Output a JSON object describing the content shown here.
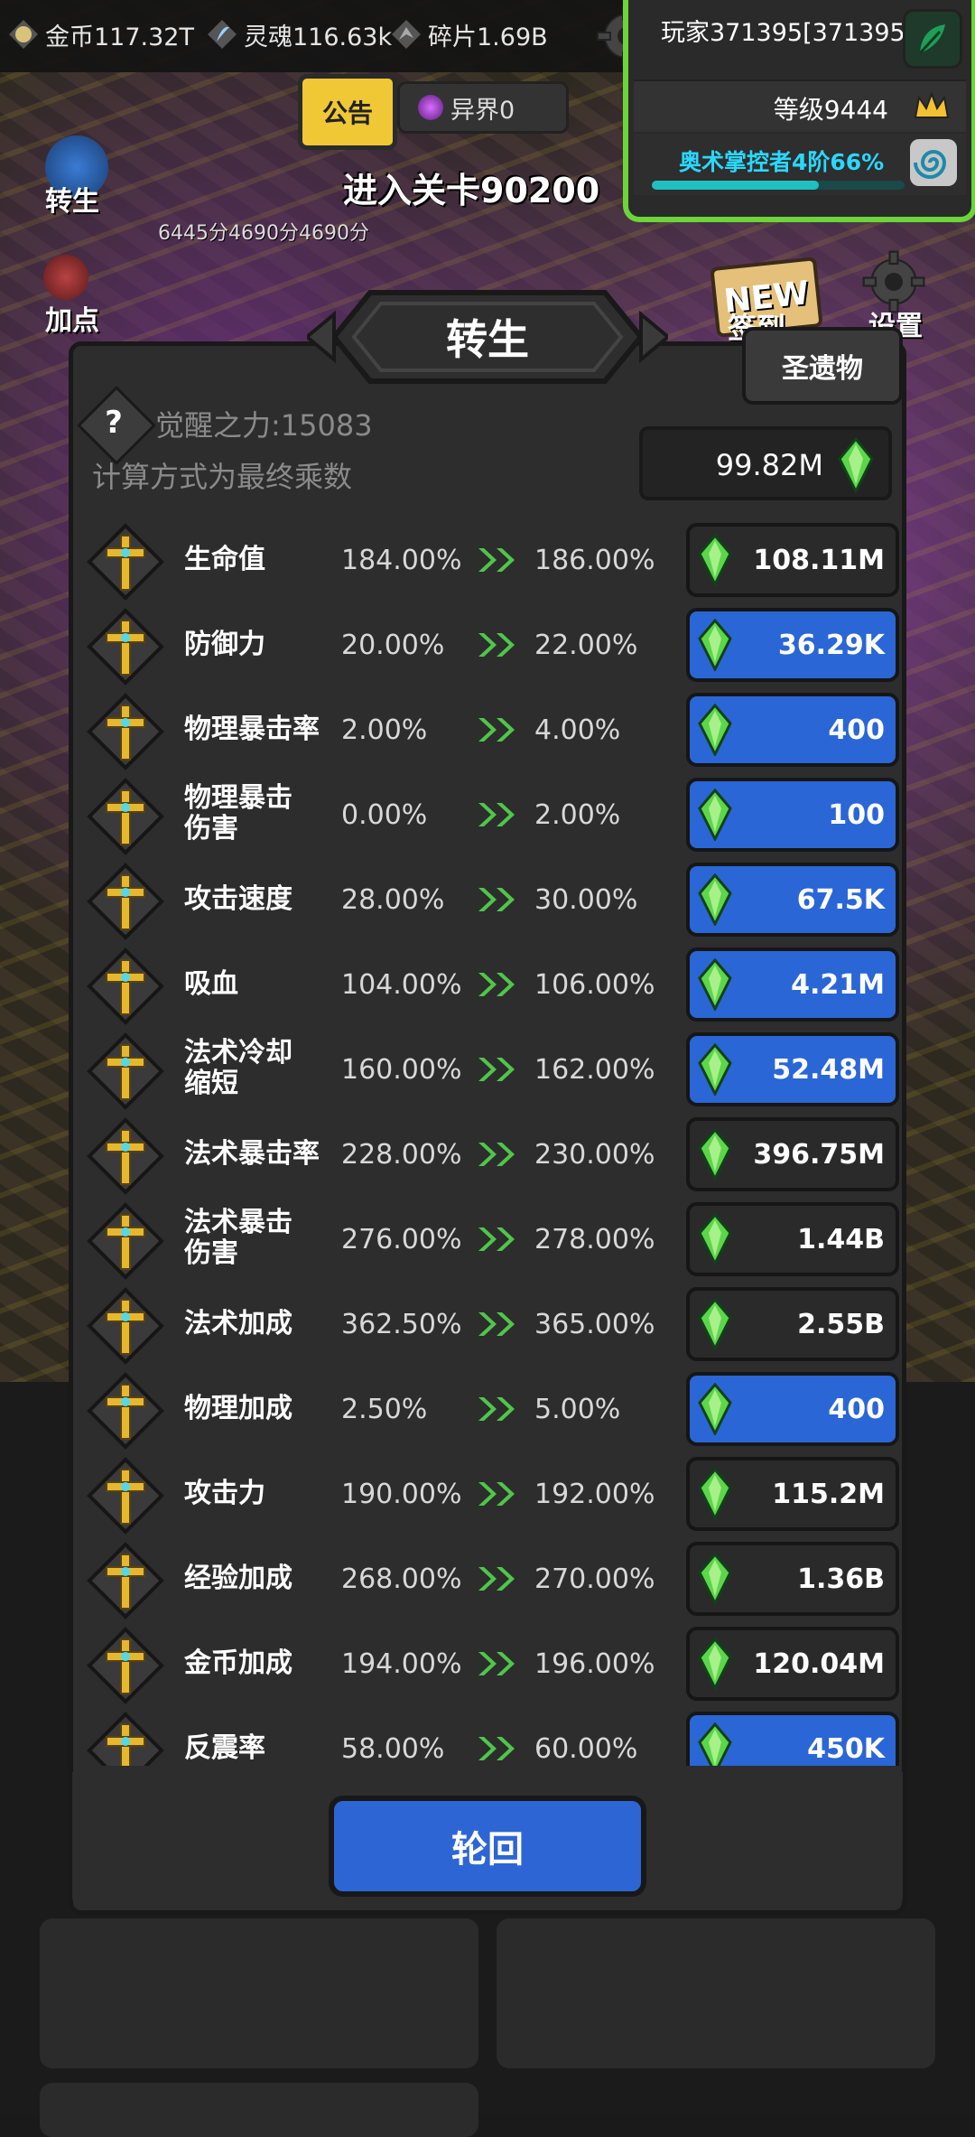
{
  "resources": {
    "gold": "金币117.32T",
    "soul": "灵魂116.63k",
    "shard": "碎片1.69B"
  },
  "player": {
    "name": "玩家371395[371395]",
    "level": "等级9444",
    "title": "奥术掌控者4阶66%",
    "title_progress": 0.66
  },
  "top_buttons": {
    "notice": "公告",
    "realm": "异界0"
  },
  "side_menu": {
    "rebirth": "转生",
    "add_points": "加点",
    "checkin": "签到",
    "settings": "设置",
    "new_badge": "NEW"
  },
  "stage": {
    "title": "进入关卡90200",
    "score": "6445分4690分4690分"
  },
  "dialog": {
    "title": "转生",
    "relic_button": "圣遗物",
    "help_mark": "?",
    "awaken_power": "觉醒之力:15083",
    "calc_note": "计算方式为最终乘数",
    "total_cost": "99.82M",
    "reincarnate_button": "轮回"
  },
  "stats": [
    {
      "name": "生命值",
      "current": "184.00%",
      "next": "186.00%",
      "cost": "108.11M",
      "affordable": false
    },
    {
      "name": "防御力",
      "current": "20.00%",
      "next": "22.00%",
      "cost": "36.29K",
      "affordable": true
    },
    {
      "name": "物理暴击率",
      "current": "2.00%",
      "next": "4.00%",
      "cost": "400",
      "affordable": true
    },
    {
      "name": "物理暴击伤害",
      "current": "0.00%",
      "next": "2.00%",
      "cost": "100",
      "affordable": true
    },
    {
      "name": "攻击速度",
      "current": "28.00%",
      "next": "30.00%",
      "cost": "67.5K",
      "affordable": true
    },
    {
      "name": "吸血",
      "current": "104.00%",
      "next": "106.00%",
      "cost": "4.21M",
      "affordable": true
    },
    {
      "name": "法术冷却缩短",
      "current": "160.00%",
      "next": "162.00%",
      "cost": "52.48M",
      "affordable": true
    },
    {
      "name": "法术暴击率",
      "current": "228.00%",
      "next": "230.00%",
      "cost": "396.75M",
      "affordable": false
    },
    {
      "name": "法术暴击伤害",
      "current": "276.00%",
      "next": "278.00%",
      "cost": "1.44B",
      "affordable": false
    },
    {
      "name": "法术加成",
      "current": "362.50%",
      "next": "365.00%",
      "cost": "2.55B",
      "affordable": false
    },
    {
      "name": "物理加成",
      "current": "2.50%",
      "next": "5.00%",
      "cost": "400",
      "affordable": true
    },
    {
      "name": "攻击力",
      "current": "190.00%",
      "next": "192.00%",
      "cost": "115.2M",
      "affordable": false
    },
    {
      "name": "经验加成",
      "current": "268.00%",
      "next": "270.00%",
      "cost": "1.36B",
      "affordable": false
    },
    {
      "name": "金币加成",
      "current": "194.00%",
      "next": "196.00%",
      "cost": "120.04M",
      "affordable": false
    },
    {
      "name": "反震率",
      "current": "58.00%",
      "next": "60.00%",
      "cost": "450K",
      "affordable": true
    }
  ],
  "colors": {
    "affordable": "#2a66d6",
    "unaffordable": "#2a2a2a",
    "accent_green": "#6bd53a",
    "notice_yellow": "#f0c836"
  }
}
